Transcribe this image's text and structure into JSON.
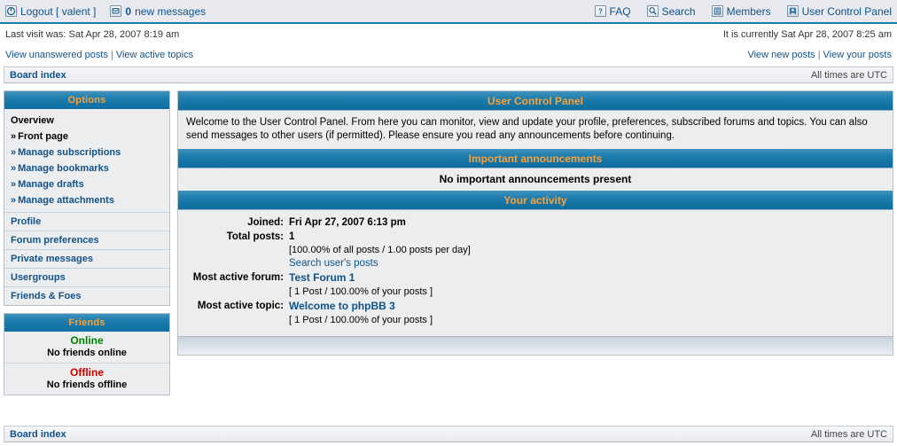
{
  "topbar": {
    "left": [
      {
        "icon": "logout-icon",
        "label": "Logout [ valent ]"
      },
      {
        "icon": "message-icon",
        "count": "0",
        "label": "new messages"
      }
    ],
    "right": [
      {
        "icon": "faq-icon",
        "label": "FAQ"
      },
      {
        "icon": "search-icon",
        "label": "Search"
      },
      {
        "icon": "members-icon",
        "label": "Members"
      },
      {
        "icon": "ucp-icon",
        "label": "User Control Panel"
      }
    ]
  },
  "info": {
    "last_visit": "Last visit was: Sat Apr 28, 2007 8:19 am",
    "current_time": "It is currently Sat Apr 28, 2007 8:25 am",
    "left_links": [
      "View unanswered posts",
      "View active topics"
    ],
    "right_links": [
      "View new posts",
      "View your posts"
    ],
    "separator": "|"
  },
  "breadcrumb": {
    "label": "Board index",
    "timezone": "All times are UTC"
  },
  "sidebar": {
    "options": {
      "title": "Options",
      "overview_label": "Overview",
      "overview_items": [
        {
          "label": "Front page",
          "current": true
        },
        {
          "label": "Manage subscriptions",
          "current": false
        },
        {
          "label": "Manage bookmarks",
          "current": false
        },
        {
          "label": "Manage drafts",
          "current": false
        },
        {
          "label": "Manage attachments",
          "current": false
        }
      ],
      "arrow": "»",
      "links": [
        "Profile",
        "Forum preferences",
        "Private messages",
        "Usergroups",
        "Friends & Foes"
      ]
    },
    "friends": {
      "title": "Friends",
      "online_title": "Online",
      "online_note": "No friends online",
      "offline_title": "Offline",
      "offline_note": "No friends offline"
    }
  },
  "main": {
    "ucp": {
      "title": "User Control Panel",
      "welcome": "Welcome to the User Control Panel. From here you can monitor, view and update your profile, preferences, subscribed forums and topics. You can also send messages to other users (if permitted). Please ensure you read any announcements before continuing."
    },
    "announcements": {
      "title": "Important announcements",
      "empty": "No important announcements present"
    },
    "activity": {
      "title": "Your activity",
      "joined_label": "Joined:",
      "joined_value": "Fri Apr 27, 2007 6:13 pm",
      "total_posts_label": "Total posts:",
      "total_posts_value": "1",
      "total_posts_detail": "[100.00% of all posts / 1.00 posts per day]",
      "search_posts_link": "Search user's posts",
      "most_active_forum_label": "Most active forum:",
      "most_active_forum_value": "Test Forum 1",
      "most_active_forum_detail": "[ 1 Post / 100.00% of your posts ]",
      "most_active_topic_label": "Most active topic:",
      "most_active_topic_value": "Welcome to phpBB 3",
      "most_active_topic_detail": "[ 1 Post / 100.00% of your posts ]"
    }
  },
  "footer": {
    "label": "Board index",
    "timezone": "All times are UTC"
  },
  "colors": {
    "accent_orange": "#FFA034",
    "link_blue": "#105289",
    "header_blue": "#1a7bac",
    "online_green": "#008000",
    "offline_red": "#CC0000",
    "panel_bg": "#ECEDEE"
  }
}
